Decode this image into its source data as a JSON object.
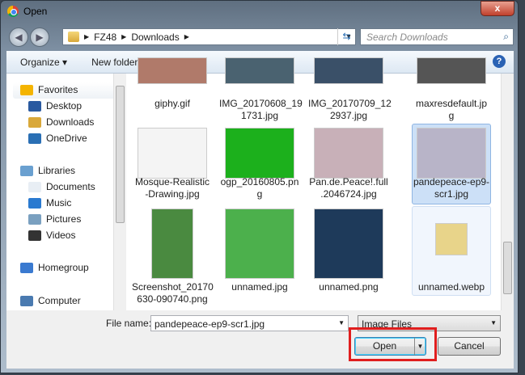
{
  "window": {
    "title": "Open",
    "close": "x"
  },
  "address": {
    "crumbs": [
      "FZ48",
      "Downloads"
    ],
    "search_placeholder": "Search Downloads"
  },
  "toolbar": {
    "organize": "Organize ▾",
    "new_folder": "New folder"
  },
  "sidebar": {
    "items": [
      {
        "label": "Favorites",
        "icon": "star-icon"
      },
      {
        "label": "Desktop",
        "icon": "desktop-icon"
      },
      {
        "label": "Downloads",
        "icon": "downloads-folder-icon"
      },
      {
        "label": "OneDrive",
        "icon": "cloud-icon"
      },
      {
        "label": "Libraries",
        "icon": "libraries-icon"
      },
      {
        "label": "Documents",
        "icon": "documents-icon"
      },
      {
        "label": "Music",
        "icon": "music-icon"
      },
      {
        "label": "Pictures",
        "icon": "pictures-icon"
      },
      {
        "label": "Videos",
        "icon": "videos-icon"
      },
      {
        "label": "Homegroup",
        "icon": "homegroup-icon"
      },
      {
        "label": "Computer",
        "icon": "computer-icon"
      }
    ]
  },
  "files": [
    {
      "l1": "giphy.gif",
      "l2": "",
      "color": "#b07a6a"
    },
    {
      "l1": "IMG_20170608_19",
      "l2": "1731.jpg",
      "color": "#4a6270"
    },
    {
      "l1": "IMG_20170709_12",
      "l2": "2937.jpg",
      "color": "#3a5068"
    },
    {
      "l1": "maxresdefault.jp",
      "l2": "g",
      "color": "#555"
    },
    {
      "l1": "Mosque-Realistic",
      "l2": "-Drawing.jpg",
      "color": "#f4f4f4"
    },
    {
      "l1": "ogp_20160805.pn",
      "l2": "g",
      "color": "#1cb01c"
    },
    {
      "l1": "Pan.de.Peace!.full",
      "l2": ".2046724.jpg",
      "color": "#c8b0b8"
    },
    {
      "l1": "pandepeace-ep9-",
      "l2": "scr1.jpg",
      "color": "#b8b4c8"
    },
    {
      "l1": "Screenshot_20170",
      "l2": "630-090740.png",
      "color": "#4a8a40"
    },
    {
      "l1": "unnamed.jpg",
      "l2": "",
      "color": "#4cb04c"
    },
    {
      "l1": "unnamed.png",
      "l2": "",
      "color": "#1e3a5a"
    },
    {
      "l1": "unnamed.webp",
      "l2": "",
      "color": "#e8d48a"
    }
  ],
  "bottom": {
    "file_name_label": "File name:",
    "file_name_value": "pandepeace-ep9-scr1.jpg",
    "filter": "Image Files",
    "open": "Open",
    "cancel": "Cancel"
  }
}
